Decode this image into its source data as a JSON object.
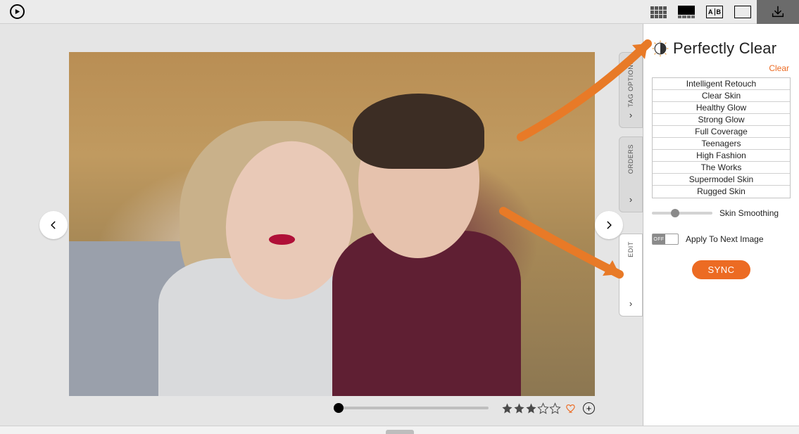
{
  "brand": {
    "title": "Perfectly Clear"
  },
  "panel": {
    "clear_label": "Clear",
    "presets": [
      "Intelligent Retouch",
      "Clear Skin",
      "Healthy Glow",
      "Strong Glow",
      "Full Coverage",
      "Teenagers",
      "High Fashion",
      "The Works",
      "Supermodel Skin",
      "Rugged Skin"
    ],
    "slider": {
      "label": "Skin Smoothing",
      "value_percent": 36
    },
    "apply_next": {
      "label": "Apply To Next Image",
      "state": "OFF"
    },
    "sync_label": "SYNC"
  },
  "tabs": {
    "tag_options": "TAG OPTIONS",
    "orders": "ORDERS",
    "edit": "EDIT"
  },
  "footer": {
    "rating_filled": 3,
    "rating_total": 5,
    "favorite": false
  },
  "colors": {
    "accent": "#ec6b23"
  }
}
